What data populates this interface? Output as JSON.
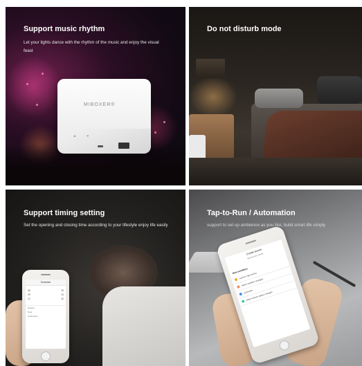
{
  "panels": [
    {
      "title": "Support music rhythm",
      "subtitle": "Let your lights dance with the rhythm of the music and enjoy the visual feast",
      "device_logo": "MIBOXER®"
    },
    {
      "title": "Do not disturb mode",
      "subtitle": ""
    },
    {
      "title": "Support timing setting",
      "subtitle": "Set the opening and closing time according to your lifestyle enjoy life easily"
    },
    {
      "title": "Tap-to-Run / Automation",
      "subtitle": "support to set up ambience as you like, build smart life simply"
    }
  ]
}
